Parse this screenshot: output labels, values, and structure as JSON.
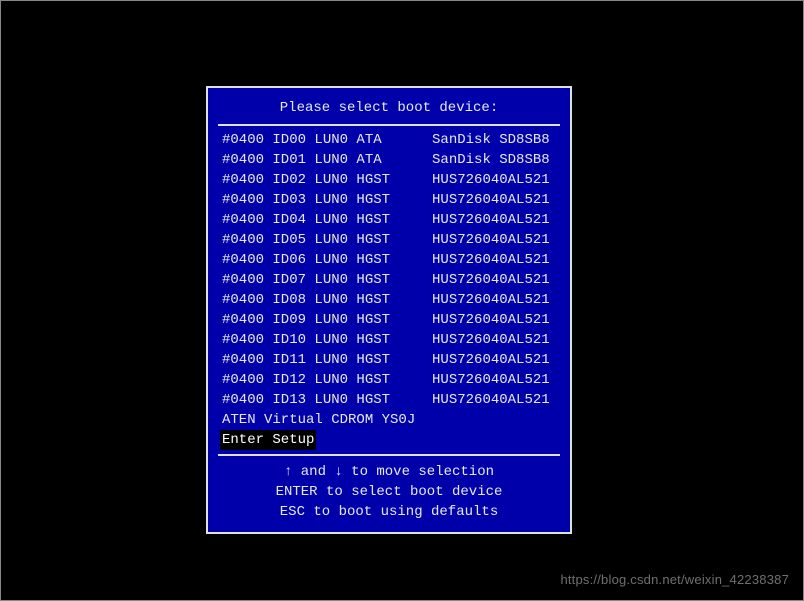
{
  "title": "Please select boot device:",
  "devices": [
    {
      "col1": "#0400 ID00 LUN0 ATA",
      "col2": "SanDisk SD8SB8",
      "selected": false
    },
    {
      "col1": "#0400 ID01 LUN0 ATA",
      "col2": "SanDisk SD8SB8",
      "selected": false
    },
    {
      "col1": "#0400 ID02 LUN0 HGST",
      "col2": "HUS726040AL521",
      "selected": false
    },
    {
      "col1": "#0400 ID03 LUN0 HGST",
      "col2": "HUS726040AL521",
      "selected": false
    },
    {
      "col1": "#0400 ID04 LUN0 HGST",
      "col2": "HUS726040AL521",
      "selected": false
    },
    {
      "col1": "#0400 ID05 LUN0 HGST",
      "col2": "HUS726040AL521",
      "selected": false
    },
    {
      "col1": "#0400 ID06 LUN0 HGST",
      "col2": "HUS726040AL521",
      "selected": false
    },
    {
      "col1": "#0400 ID07 LUN0 HGST",
      "col2": "HUS726040AL521",
      "selected": false
    },
    {
      "col1": "#0400 ID08 LUN0 HGST",
      "col2": "HUS726040AL521",
      "selected": false
    },
    {
      "col1": "#0400 ID09 LUN0 HGST",
      "col2": "HUS726040AL521",
      "selected": false
    },
    {
      "col1": "#0400 ID10 LUN0 HGST",
      "col2": "HUS726040AL521",
      "selected": false
    },
    {
      "col1": "#0400 ID11 LUN0 HGST",
      "col2": "HUS726040AL521",
      "selected": false
    },
    {
      "col1": "#0400 ID12 LUN0 HGST",
      "col2": "HUS726040AL521",
      "selected": false
    },
    {
      "col1": "#0400 ID13 LUN0 HGST",
      "col2": "HUS726040AL521",
      "selected": false
    },
    {
      "col1": "ATEN Virtual CDROM YS0J",
      "col2": "",
      "selected": false
    },
    {
      "col1": "Enter Setup",
      "col2": "",
      "selected": true
    }
  ],
  "instructions": {
    "line1": "↑ and ↓ to move selection",
    "line2": "ENTER to select boot device",
    "line3": "ESC to boot using defaults"
  },
  "watermark": "https://blog.csdn.net/weixin_42238387"
}
